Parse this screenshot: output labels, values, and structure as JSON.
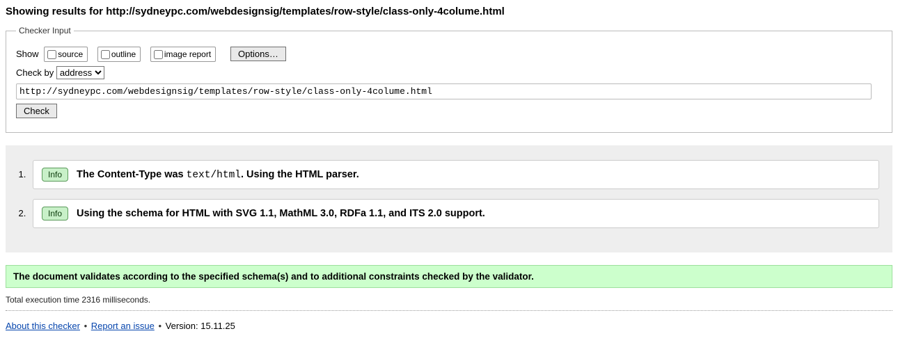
{
  "heading_prefix": "Showing results for ",
  "heading_url": "http://sydneypc.com/webdesignsig/templates/row-style/class-only-4colume.html",
  "checker": {
    "legend": "Checker Input",
    "show_label": "Show",
    "cb_source": "source",
    "cb_outline": "outline",
    "cb_image": "image report",
    "options_btn": "Options…",
    "checkby_label": "Check by",
    "checkby_selected": "address",
    "address_value": "http://sydneypc.com/webdesignsig/templates/row-style/class-only-4colume.html",
    "check_btn": "Check"
  },
  "results": {
    "info_badge": "Info",
    "msg1_pre": "The Content-Type was ",
    "msg1_code": "text/html",
    "msg1_post": ". Using the HTML parser.",
    "msg2": "Using the schema for HTML with SVG 1.1, MathML 3.0, RDFa 1.1, and ITS 2.0 support."
  },
  "success_msg": "The document validates according to the specified schema(s) and to additional constraints checked by the validator.",
  "timing": "Total execution time 2316 milliseconds.",
  "footer": {
    "about": "About this checker",
    "report": "Report an issue",
    "version_label": "Version: ",
    "version": "15.11.25"
  }
}
